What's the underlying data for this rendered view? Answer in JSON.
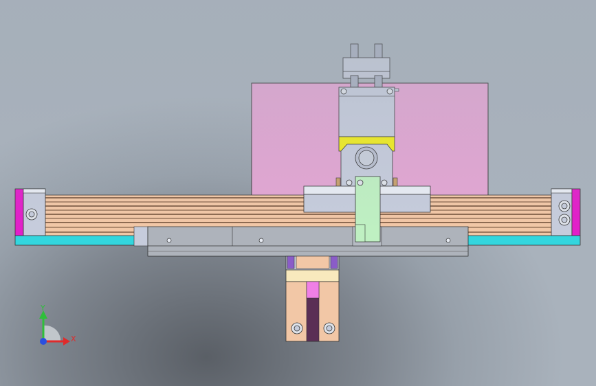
{
  "triad": {
    "y_label": "Y",
    "x_label": "X",
    "y_color": "#2fbf3a",
    "x_color": "#e02b2b",
    "z_color": "#2a4fe0"
  },
  "colors": {
    "plate": "#e3a6d3",
    "rail": "#f2c7a6",
    "rail_line": "#6b4a33",
    "end_cap": "#e21fc9",
    "base_strip": "#33d6de",
    "slider": "#c6ccdc",
    "slider_face": "#e8ecf4",
    "cylinder": "#b9bfcf",
    "yellow": "#f2ee1c",
    "green_arm": "#bff0c2",
    "carriage": "#aeb3bb",
    "lower_block": "#f2c7a6",
    "lower_slot": "#5a2f55",
    "lower_pink": "#f07fe6"
  }
}
